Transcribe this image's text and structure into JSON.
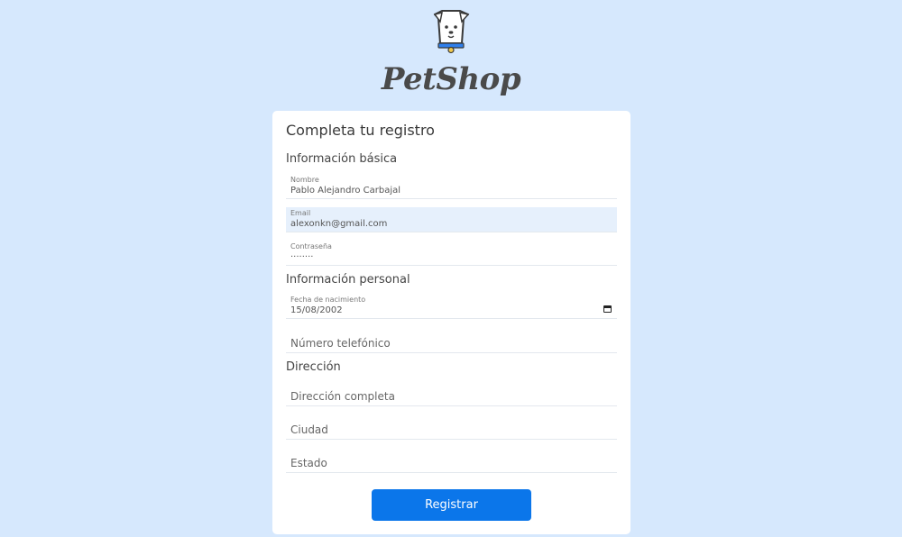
{
  "brand": {
    "name": "PetShop",
    "logo_icon": "dog-icon"
  },
  "form": {
    "title": "Completa tu registro",
    "sections": {
      "basic": "Información básica",
      "personal": "Información personal",
      "address": "Dirección"
    },
    "fields": {
      "nombre": {
        "label": "Nombre",
        "value": "Pablo Alejandro Carbajal"
      },
      "email": {
        "label": "Email",
        "value": "alexonkn@gmail.com"
      },
      "password": {
        "label": "Contraseña",
        "value": "········"
      },
      "birthdate": {
        "label": "Fecha de nacimiento",
        "value": "15/08/2002",
        "icon": "calendar-icon"
      },
      "phone": {
        "placeholder": "Número telefónico"
      },
      "address": {
        "placeholder": "Dirección completa"
      },
      "city": {
        "placeholder": "Ciudad"
      },
      "state": {
        "placeholder": "Estado"
      }
    },
    "submit_label": "Registrar"
  },
  "colors": {
    "background": "#d6e8fd",
    "card": "#ffffff",
    "button": "#0b76ea",
    "focused_field": "#e6f0fc",
    "collar": "#2f80ed"
  }
}
